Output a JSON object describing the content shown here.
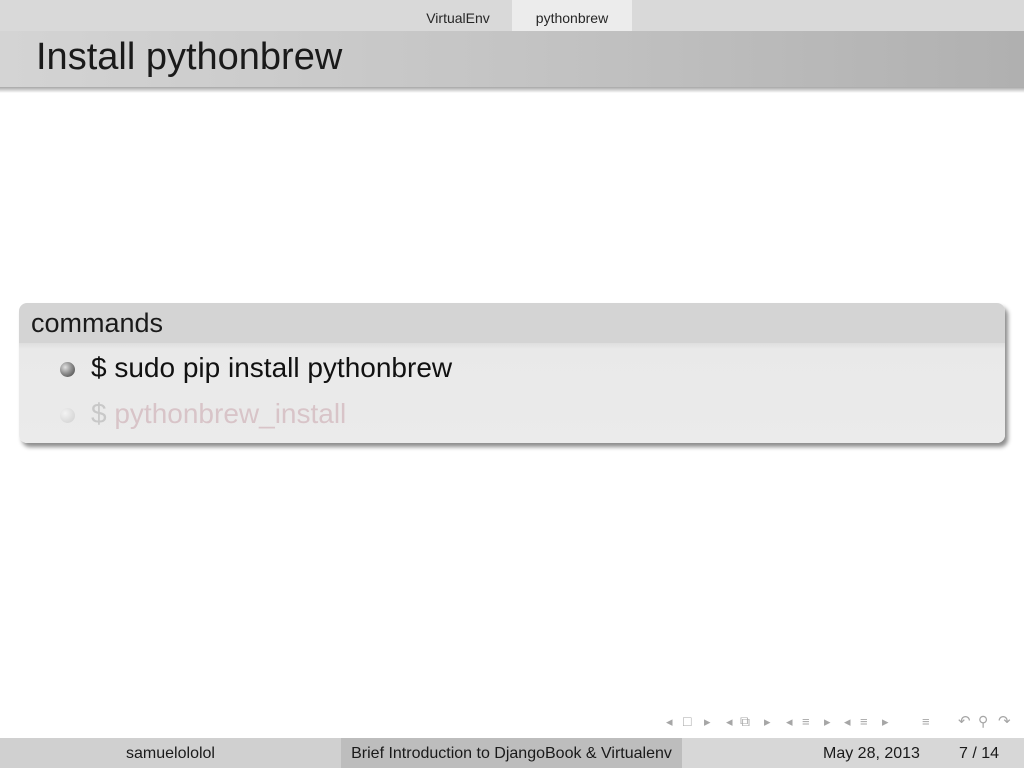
{
  "nav": {
    "sections": [
      "VirtualEnv",
      "pythonbrew"
    ],
    "active_section": "pythonbrew"
  },
  "slide": {
    "title": "Install pythonbrew",
    "block": {
      "title": "commands",
      "items": [
        {
          "text": "$ sudo pip install pythonbrew",
          "visible": true
        },
        {
          "dollar": "$",
          "text": "pythonbrew_install",
          "visible": false
        }
      ]
    }
  },
  "nav_symbols": [
    "frame-prev-icon",
    "frame-icon",
    "frame-next-icon",
    "subsection-prev-icon",
    "subsection-icon",
    "subsection-next-icon",
    "section-prev-icon",
    "section-icon",
    "section-next-icon",
    "toc-prev-icon",
    "toc-icon",
    "toc-next-icon",
    "align-icon",
    "undo-icon",
    "search-icon",
    "redo-icon"
  ],
  "footer": {
    "author": "samuelololol",
    "short_title": "Brief Introduction to DjangoBook & Virtualenv",
    "date": "May 28, 2013",
    "page": "7 / 14"
  },
  "colors": {
    "header_bar": "#d9d9d9",
    "title_bar": "#c4c4c4",
    "block_header": "#d4d4d4",
    "block_body": "#ebebeb",
    "dimmed_text": "#d8c4c8"
  }
}
